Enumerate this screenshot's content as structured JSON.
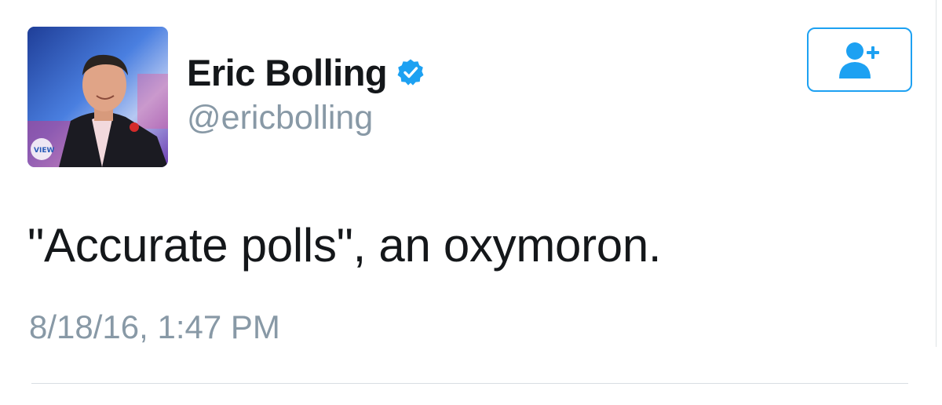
{
  "tweet": {
    "display_name": "Eric Bolling",
    "handle": "@ericbolling",
    "verified": true,
    "text": "\"Accurate polls\", an oxymoron.",
    "timestamp": "8/18/16, 1:47 PM"
  },
  "follow_button": {
    "icon": "add-user-icon"
  },
  "avatar": {
    "badge_text": "VIEW"
  },
  "colors": {
    "accent": "#1da1f2",
    "name": "#14171a",
    "secondary": "#8899a6",
    "verified": "#1da1f2"
  }
}
